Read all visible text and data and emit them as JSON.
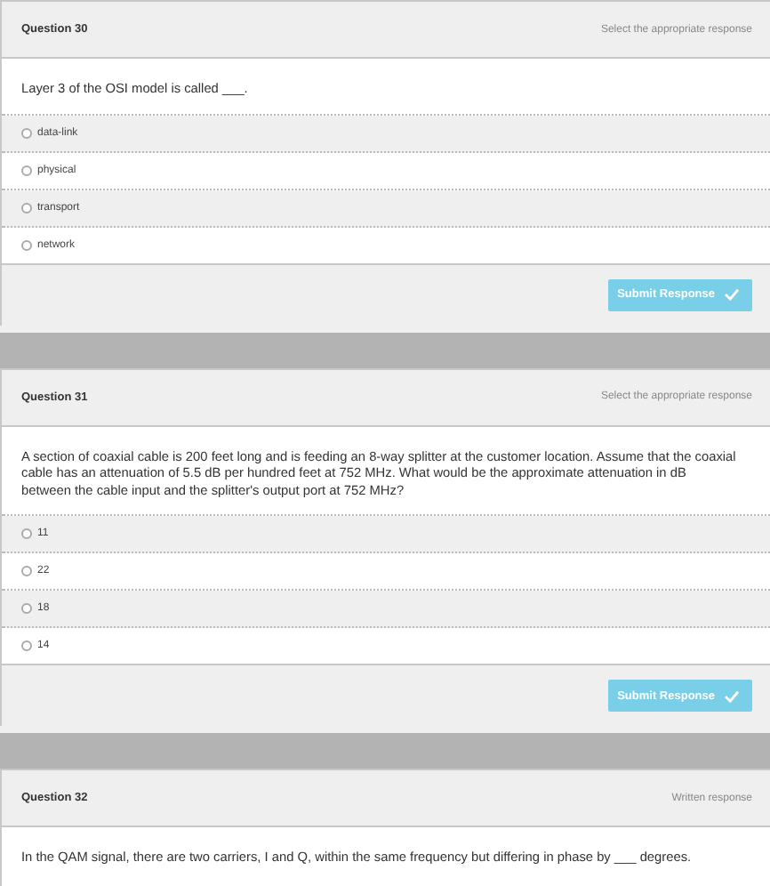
{
  "questions": [
    {
      "title": "Question 30",
      "kind": "choice",
      "response_type": "Select the appropriate response",
      "prompt": "Layer 3 of the OSI model is called ___.",
      "options": [
        {
          "label": "data-link",
          "selected": false
        },
        {
          "label": "physical",
          "selected": false
        },
        {
          "label": "transport",
          "selected": false
        },
        {
          "label": "network",
          "selected": false
        }
      ],
      "submit": "Submit Response"
    },
    {
      "title": "Question 31",
      "kind": "choice",
      "response_type": "Select the appropriate response",
      "prompt": "A section of coaxial cable is 200 feet long and is feeding an 8-way splitter at the customer location. Assume that the coaxial cable has an attenuation of 5.5 dB per hundred feet at 752 MHz. What would be the approximate attenuation in dB between the cable input and the splitter's output port at 752 MHz?",
      "options": [
        {
          "label": "11",
          "selected": false
        },
        {
          "label": "22",
          "selected": false
        },
        {
          "label": "18",
          "selected": false
        },
        {
          "label": "14",
          "selected": false
        }
      ],
      "submit": "Submit Response"
    },
    {
      "title": "Question 32",
      "kind": "written",
      "response_type": "Written response",
      "prompt": "In the QAM signal, there are two carriers, I and Q, within the same frequency but differing in phase by ___ degrees."
    }
  ]
}
